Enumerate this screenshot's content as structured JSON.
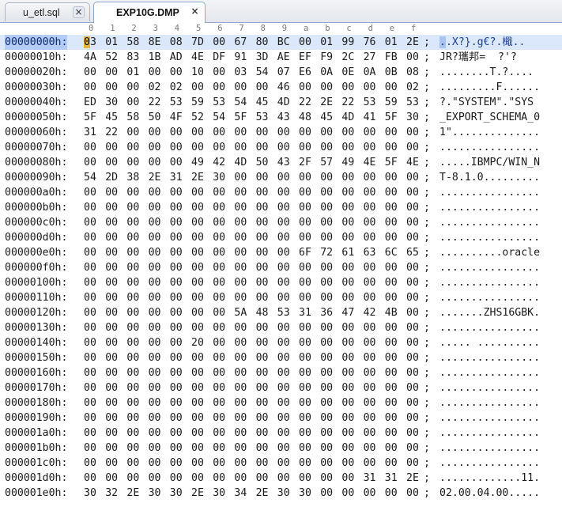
{
  "tabs": [
    {
      "label": "u_etl.sql",
      "close": "×"
    },
    {
      "label": "EXP10G.DMP",
      "close": "×"
    }
  ],
  "ruler": [
    "0",
    "1",
    "2",
    "3",
    "4",
    "5",
    "6",
    "7",
    "8",
    "9",
    "a",
    "b",
    "c",
    "d",
    "e",
    "f"
  ],
  "separator": ";",
  "rows": [
    {
      "addr": "00000000h:",
      "bytes": [
        "03",
        "01",
        "58",
        "8E",
        "08",
        "7D",
        "00",
        "67",
        "80",
        "BC",
        "00",
        "01",
        "99",
        "76",
        "01",
        "2E"
      ],
      "ascii": "..X?}.g€?.檝.."
    },
    {
      "addr": "00000010h:",
      "bytes": [
        "4A",
        "52",
        "83",
        "1B",
        "AD",
        "4E",
        "DF",
        "91",
        "3D",
        "AE",
        "EF",
        "F9",
        "2C",
        "27",
        "FB",
        "00"
      ],
      "ascii": "JR?瓗邦=  ?'?"
    },
    {
      "addr": "00000020h:",
      "bytes": [
        "00",
        "00",
        "01",
        "00",
        "00",
        "10",
        "00",
        "03",
        "54",
        "07",
        "E6",
        "0A",
        "0E",
        "0A",
        "0B",
        "08"
      ],
      "ascii": "........T.?...."
    },
    {
      "addr": "00000030h:",
      "bytes": [
        "00",
        "00",
        "00",
        "02",
        "02",
        "00",
        "00",
        "00",
        "00",
        "46",
        "00",
        "00",
        "00",
        "00",
        "00",
        "02"
      ],
      "ascii": ".........F......"
    },
    {
      "addr": "00000040h:",
      "bytes": [
        "ED",
        "30",
        "00",
        "22",
        "53",
        "59",
        "53",
        "54",
        "45",
        "4D",
        "22",
        "2E",
        "22",
        "53",
        "59",
        "53"
      ],
      "ascii": "?.\"SYSTEM\".\"SYS"
    },
    {
      "addr": "00000050h:",
      "bytes": [
        "5F",
        "45",
        "58",
        "50",
        "4F",
        "52",
        "54",
        "5F",
        "53",
        "43",
        "48",
        "45",
        "4D",
        "41",
        "5F",
        "30"
      ],
      "ascii": "_EXPORT_SCHEMA_0"
    },
    {
      "addr": "00000060h:",
      "bytes": [
        "31",
        "22",
        "00",
        "00",
        "00",
        "00",
        "00",
        "00",
        "00",
        "00",
        "00",
        "00",
        "00",
        "00",
        "00",
        "00"
      ],
      "ascii": "1\".............."
    },
    {
      "addr": "00000070h:",
      "bytes": [
        "00",
        "00",
        "00",
        "00",
        "00",
        "00",
        "00",
        "00",
        "00",
        "00",
        "00",
        "00",
        "00",
        "00",
        "00",
        "00"
      ],
      "ascii": "................"
    },
    {
      "addr": "00000080h:",
      "bytes": [
        "00",
        "00",
        "00",
        "00",
        "00",
        "49",
        "42",
        "4D",
        "50",
        "43",
        "2F",
        "57",
        "49",
        "4E",
        "5F",
        "4E"
      ],
      "ascii": ".....IBMPC/WIN_N"
    },
    {
      "addr": "00000090h:",
      "bytes": [
        "54",
        "2D",
        "38",
        "2E",
        "31",
        "2E",
        "30",
        "00",
        "00",
        "00",
        "00",
        "00",
        "00",
        "00",
        "00",
        "00"
      ],
      "ascii": "T-8.1.0........."
    },
    {
      "addr": "000000a0h:",
      "bytes": [
        "00",
        "00",
        "00",
        "00",
        "00",
        "00",
        "00",
        "00",
        "00",
        "00",
        "00",
        "00",
        "00",
        "00",
        "00",
        "00"
      ],
      "ascii": "................"
    },
    {
      "addr": "000000b0h:",
      "bytes": [
        "00",
        "00",
        "00",
        "00",
        "00",
        "00",
        "00",
        "00",
        "00",
        "00",
        "00",
        "00",
        "00",
        "00",
        "00",
        "00"
      ],
      "ascii": "................"
    },
    {
      "addr": "000000c0h:",
      "bytes": [
        "00",
        "00",
        "00",
        "00",
        "00",
        "00",
        "00",
        "00",
        "00",
        "00",
        "00",
        "00",
        "00",
        "00",
        "00",
        "00"
      ],
      "ascii": "................"
    },
    {
      "addr": "000000d0h:",
      "bytes": [
        "00",
        "00",
        "00",
        "00",
        "00",
        "00",
        "00",
        "00",
        "00",
        "00",
        "00",
        "00",
        "00",
        "00",
        "00",
        "00"
      ],
      "ascii": "................"
    },
    {
      "addr": "000000e0h:",
      "bytes": [
        "00",
        "00",
        "00",
        "00",
        "00",
        "00",
        "00",
        "00",
        "00",
        "00",
        "6F",
        "72",
        "61",
        "63",
        "6C",
        "65"
      ],
      "ascii": "..........oracle"
    },
    {
      "addr": "000000f0h:",
      "bytes": [
        "00",
        "00",
        "00",
        "00",
        "00",
        "00",
        "00",
        "00",
        "00",
        "00",
        "00",
        "00",
        "00",
        "00",
        "00",
        "00"
      ],
      "ascii": "................"
    },
    {
      "addr": "00000100h:",
      "bytes": [
        "00",
        "00",
        "00",
        "00",
        "00",
        "00",
        "00",
        "00",
        "00",
        "00",
        "00",
        "00",
        "00",
        "00",
        "00",
        "00"
      ],
      "ascii": "................"
    },
    {
      "addr": "00000110h:",
      "bytes": [
        "00",
        "00",
        "00",
        "00",
        "00",
        "00",
        "00",
        "00",
        "00",
        "00",
        "00",
        "00",
        "00",
        "00",
        "00",
        "00"
      ],
      "ascii": "................"
    },
    {
      "addr": "00000120h:",
      "bytes": [
        "00",
        "00",
        "00",
        "00",
        "00",
        "00",
        "00",
        "5A",
        "48",
        "53",
        "31",
        "36",
        "47",
        "42",
        "4B",
        "00"
      ],
      "ascii": ".......ZHS16GBK."
    },
    {
      "addr": "00000130h:",
      "bytes": [
        "00",
        "00",
        "00",
        "00",
        "00",
        "00",
        "00",
        "00",
        "00",
        "00",
        "00",
        "00",
        "00",
        "00",
        "00",
        "00"
      ],
      "ascii": "................"
    },
    {
      "addr": "00000140h:",
      "bytes": [
        "00",
        "00",
        "00",
        "00",
        "00",
        "20",
        "00",
        "00",
        "00",
        "00",
        "00",
        "00",
        "00",
        "00",
        "00",
        "00"
      ],
      "ascii": "..... .........."
    },
    {
      "addr": "00000150h:",
      "bytes": [
        "00",
        "00",
        "00",
        "00",
        "00",
        "00",
        "00",
        "00",
        "00",
        "00",
        "00",
        "00",
        "00",
        "00",
        "00",
        "00"
      ],
      "ascii": "................"
    },
    {
      "addr": "00000160h:",
      "bytes": [
        "00",
        "00",
        "00",
        "00",
        "00",
        "00",
        "00",
        "00",
        "00",
        "00",
        "00",
        "00",
        "00",
        "00",
        "00",
        "00"
      ],
      "ascii": "................"
    },
    {
      "addr": "00000170h:",
      "bytes": [
        "00",
        "00",
        "00",
        "00",
        "00",
        "00",
        "00",
        "00",
        "00",
        "00",
        "00",
        "00",
        "00",
        "00",
        "00",
        "00"
      ],
      "ascii": "................"
    },
    {
      "addr": "00000180h:",
      "bytes": [
        "00",
        "00",
        "00",
        "00",
        "00",
        "00",
        "00",
        "00",
        "00",
        "00",
        "00",
        "00",
        "00",
        "00",
        "00",
        "00"
      ],
      "ascii": "................"
    },
    {
      "addr": "00000190h:",
      "bytes": [
        "00",
        "00",
        "00",
        "00",
        "00",
        "00",
        "00",
        "00",
        "00",
        "00",
        "00",
        "00",
        "00",
        "00",
        "00",
        "00"
      ],
      "ascii": "................"
    },
    {
      "addr": "000001a0h:",
      "bytes": [
        "00",
        "00",
        "00",
        "00",
        "00",
        "00",
        "00",
        "00",
        "00",
        "00",
        "00",
        "00",
        "00",
        "00",
        "00",
        "00"
      ],
      "ascii": "................"
    },
    {
      "addr": "000001b0h:",
      "bytes": [
        "00",
        "00",
        "00",
        "00",
        "00",
        "00",
        "00",
        "00",
        "00",
        "00",
        "00",
        "00",
        "00",
        "00",
        "00",
        "00"
      ],
      "ascii": "................"
    },
    {
      "addr": "000001c0h:",
      "bytes": [
        "00",
        "00",
        "00",
        "00",
        "00",
        "00",
        "00",
        "00",
        "00",
        "00",
        "00",
        "00",
        "00",
        "00",
        "00",
        "00"
      ],
      "ascii": "................"
    },
    {
      "addr": "000001d0h:",
      "bytes": [
        "00",
        "00",
        "00",
        "00",
        "00",
        "00",
        "00",
        "00",
        "00",
        "00",
        "00",
        "00",
        "00",
        "31",
        "31",
        "2E"
      ],
      "ascii": ".............11."
    },
    {
      "addr": "000001e0h:",
      "bytes": [
        "30",
        "32",
        "2E",
        "30",
        "30",
        "2E",
        "30",
        "34",
        "2E",
        "30",
        "30",
        "00",
        "00",
        "00",
        "00",
        "00"
      ],
      "ascii": "02.00.04.00....."
    }
  ],
  "selected_row": 0,
  "cursor_byte": 0,
  "colors": {
    "selection": "#dbe7fb",
    "address_highlight": "#b3ccf5",
    "cursor": "#e8b440",
    "tab_border": "#8aa6c8"
  }
}
